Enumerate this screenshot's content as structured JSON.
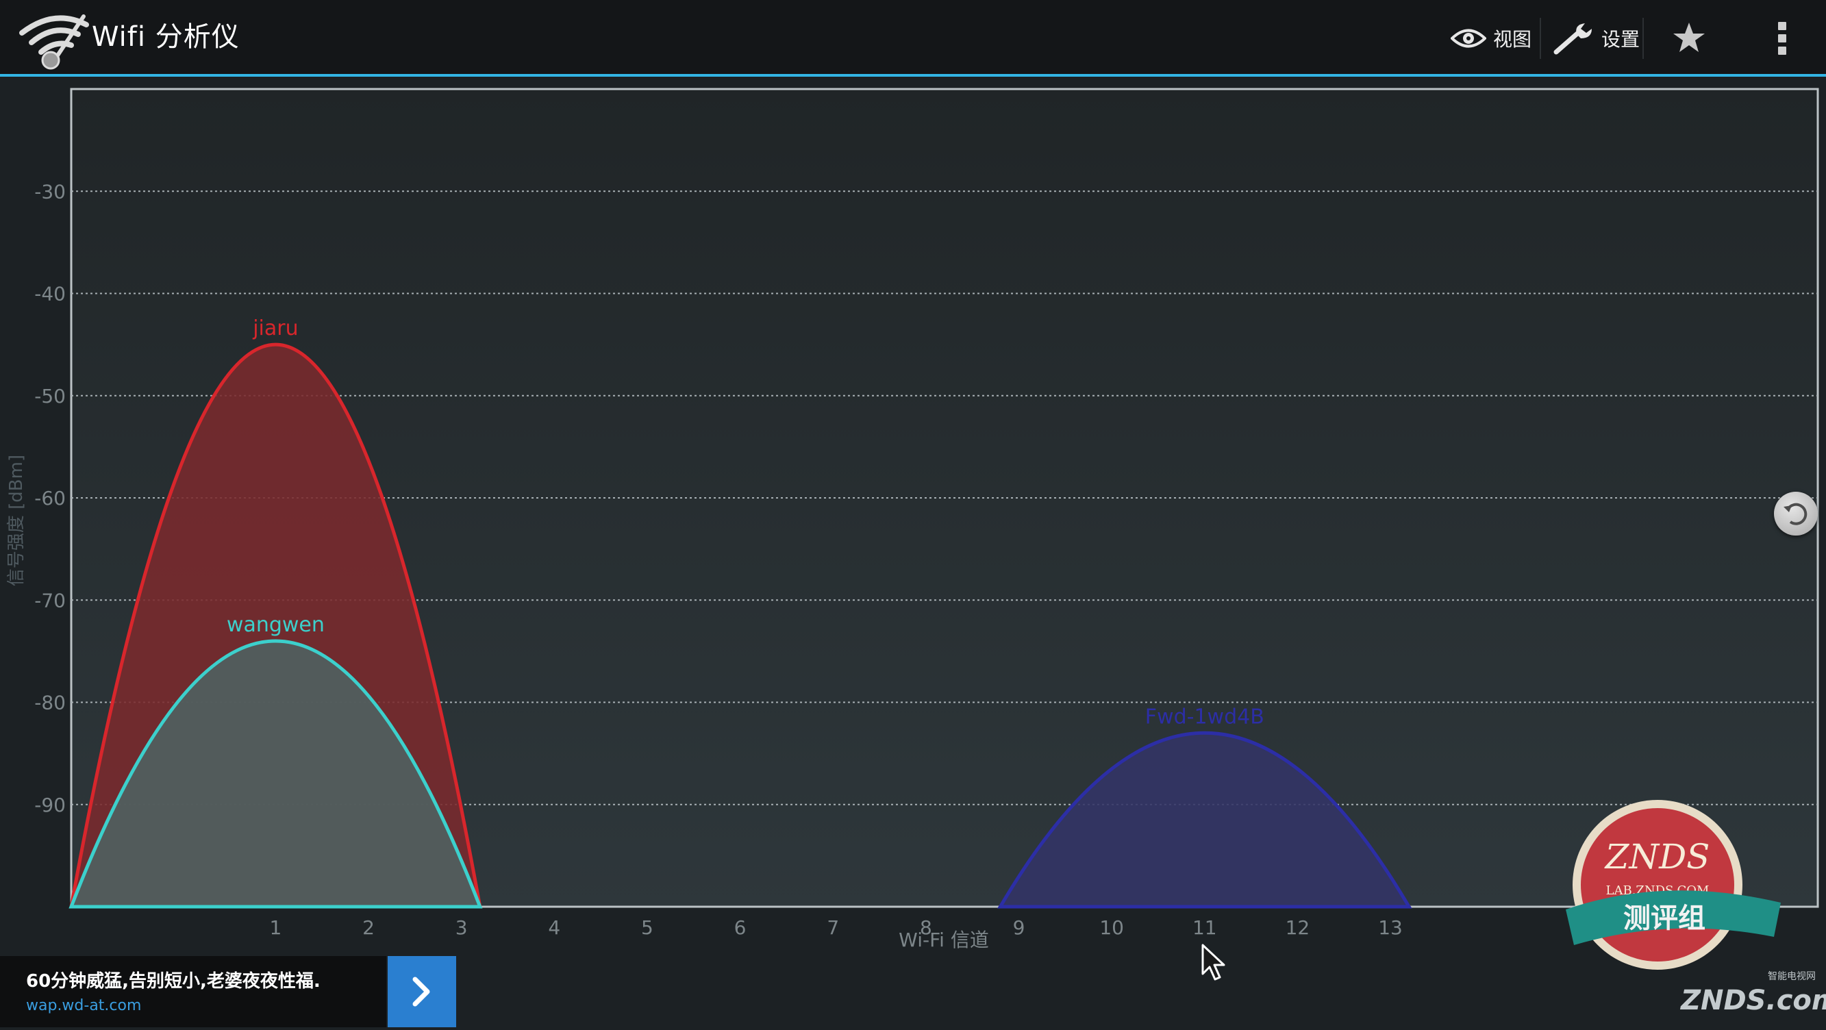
{
  "app": {
    "title": "Wifi 分析仪"
  },
  "actionbar": {
    "view_label": "视图",
    "settings_label": "设置",
    "icons": [
      "wifi-app-icon",
      "eye-icon",
      "wrench-icon",
      "star-icon",
      "overflow-menu-icon"
    ]
  },
  "chart_data": {
    "type": "area",
    "ylabel": "信号强度 [dBm]",
    "xlabel": "Wi-Fi 信道",
    "ylim": [
      -100,
      -20
    ],
    "xlim": [
      -1.2,
      17.6
    ],
    "yticks": [
      "-30",
      "-40",
      "-50",
      "-60",
      "-70",
      "-80",
      "-90"
    ],
    "xticks": [
      "1",
      "2",
      "3",
      "4",
      "5",
      "6",
      "7",
      "8",
      "9",
      "10",
      "11",
      "12",
      "13"
    ],
    "grid": "horizontal-dotted",
    "series": [
      {
        "name": "jiaru",
        "channel": 1,
        "width": 2.2,
        "signal": -45,
        "color": "#d8262c",
        "fill": "#7a2a2e"
      },
      {
        "name": "wangwen",
        "channel": 1,
        "width": 2.2,
        "signal": -74,
        "color": "#3cd0cc",
        "fill": "#4d6262"
      },
      {
        "name": "Fwd-1wd4B",
        "channel": 11,
        "width": 2.2,
        "signal": -83,
        "color": "#2c2ea6",
        "fill": "#333466"
      }
    ]
  },
  "ad": {
    "text": "60分钟威猛,告别短小,老婆夜夜性福.",
    "url": "wap.wd-at.com"
  },
  "watermark": {
    "brand": "ZNDS",
    "url": "LAB.ZNDS.COM",
    "ribbon": "测评组",
    "site": "ZNDS.com",
    "site_tag": "智能电视网"
  }
}
